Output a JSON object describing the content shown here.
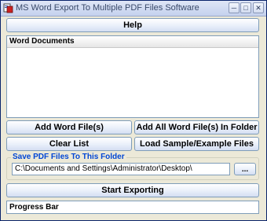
{
  "window": {
    "title": "MS Word Export To Multiple PDF Files Software"
  },
  "help_button": "Help",
  "word_documents": {
    "header": "Word Documents"
  },
  "buttons": {
    "add_word_files": "Add Word File(s)",
    "add_all_word_files_in_folder": "Add All Word File(s) In Folder",
    "clear_list": "Clear List",
    "load_sample": "Load Sample/Example Files"
  },
  "save_folder": {
    "label": "Save PDF Files To This Folder",
    "path": "C:\\Documents and Settings\\Administrator\\Desktop\\",
    "browse": "..."
  },
  "start_exporting": "Start Exporting",
  "progress_bar": "Progress Bar"
}
